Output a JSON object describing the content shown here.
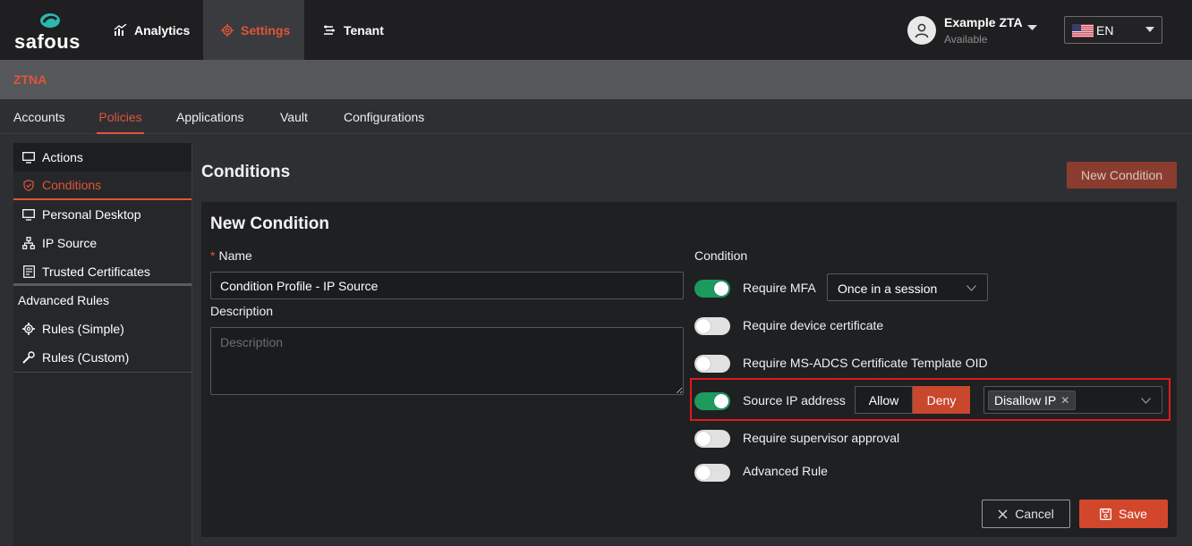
{
  "brand": {
    "name": "safous",
    "accent": "#e0553a"
  },
  "nav": {
    "analytics": "Analytics",
    "settings": "Settings",
    "tenant": "Tenant"
  },
  "user": {
    "name": "Example ZTA",
    "status": "Available"
  },
  "language": {
    "value": "EN"
  },
  "section": {
    "title": "ZTNA"
  },
  "tabs": [
    "Accounts",
    "Policies",
    "Applications",
    "Vault",
    "Configurations"
  ],
  "sidebar": {
    "items": [
      {
        "label": "Actions",
        "icon": "monitor-icon"
      },
      {
        "label": "Conditions",
        "icon": "shield-check-icon"
      },
      {
        "label": "Personal Desktop",
        "icon": "monitor-icon"
      },
      {
        "label": "IP Source",
        "icon": "network-icon"
      },
      {
        "label": "Trusted Certificates",
        "icon": "certificate-icon"
      }
    ],
    "advanced_heading": "Advanced Rules",
    "advanced_items": [
      {
        "label": "Rules (Simple)",
        "icon": "gear-icon"
      },
      {
        "label": "Rules (Custom)",
        "icon": "wrench-icon"
      }
    ]
  },
  "page": {
    "title": "Conditions",
    "new_button": "New Condition"
  },
  "form": {
    "title": "New Condition",
    "name_label": "Name",
    "name_value": "Condition Profile - IP Source",
    "description_label": "Description",
    "description_placeholder": "Description",
    "condition_label": "Condition",
    "conditions": {
      "mfa": {
        "label": "Require MFA",
        "enabled": true,
        "option": "Once in a session"
      },
      "device_cert": {
        "label": "Require device certificate",
        "enabled": false
      },
      "msadcs": {
        "label": "Require MS-ADCS Certificate Template OID",
        "enabled": false
      },
      "source_ip": {
        "label": "Source IP address",
        "enabled": true,
        "allow": "Allow",
        "deny": "Deny",
        "selected_mode": "Deny",
        "tag": "Disallow IP"
      },
      "supervisor": {
        "label": "Require supervisor approval",
        "enabled": false
      },
      "advanced": {
        "label": "Advanced Rule",
        "enabled": false
      }
    },
    "cancel": "Cancel",
    "save": "Save"
  }
}
